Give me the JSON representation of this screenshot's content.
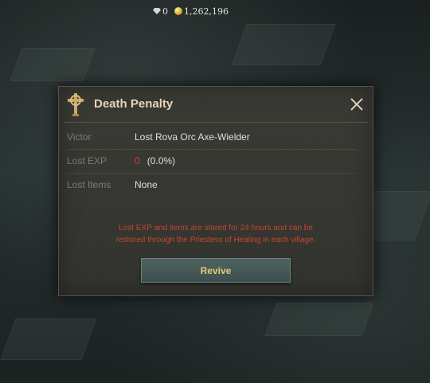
{
  "hud": {
    "gems": "0",
    "gold": "1,262,196"
  },
  "dialog": {
    "title": "Death Penalty",
    "rows": [
      {
        "label": "Victor",
        "value": "Lost Rova Orc Axe-Wielder"
      },
      {
        "label": "Lost EXP",
        "value_highlight": "0",
        "value": "(0.0%)"
      },
      {
        "label": "Lost Items",
        "value": "None"
      }
    ],
    "notice_line1": "Lost EXP and items are stored for 24 hours and can be",
    "notice_line2": "restored through the Priestess of Healing in each village.",
    "revive_label": "Revive"
  },
  "colors": {
    "accent_gold": "#e8c97a",
    "title": "#e6d5b0",
    "warning_red": "#c8452f",
    "exp_red": "#d83a2e",
    "panel": "#3a3a35",
    "button": "#4f6462"
  },
  "icons": [
    "gem-icon",
    "gold-coin-icon",
    "cross-emblem-icon",
    "close-icon"
  ]
}
